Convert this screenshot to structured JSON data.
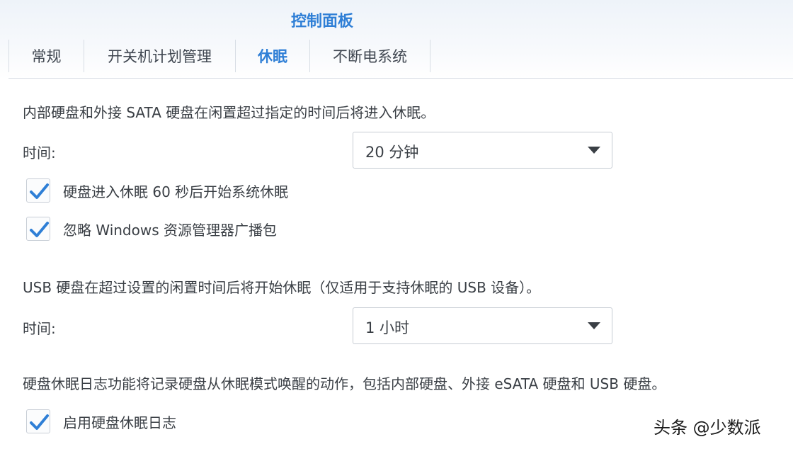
{
  "window": {
    "title": "控制面板"
  },
  "tabs": [
    {
      "label": "常规"
    },
    {
      "label": "开关机计划管理"
    },
    {
      "label": "休眠",
      "active": true
    },
    {
      "label": "不断电系统"
    }
  ],
  "internal_disk": {
    "description": "内部硬盘和外接 SATA 硬盘在闲置超过指定的时间后将进入休眠。",
    "time_label": "时间:",
    "time_value": "20 分钟",
    "options": [
      {
        "label": "硬盘进入休眠 60 秒后开始系统休眠",
        "checked": true
      },
      {
        "label": "忽略 Windows 资源管理器广播包",
        "checked": true
      }
    ]
  },
  "usb_disk": {
    "description": "USB 硬盘在超过设置的闲置时间后将开始休眠（仅适用于支持休眠的 USB 设备）。",
    "time_label": "时间:",
    "time_value": "1 小时"
  },
  "hibernation_log": {
    "description": "硬盘休眠日志功能将记录硬盘从休眠模式唤醒的动作，包括内部硬盘、外接 eSATA 硬盘和 USB 硬盘。",
    "option": {
      "label": "启用硬盘休眠日志",
      "checked": true
    }
  },
  "watermark": "头条 @少数派",
  "colors": {
    "accent": "#2f7fd6",
    "text": "#3a3f45",
    "border": "#c6ccd3"
  },
  "icons": {
    "checkbox_checked": "checkmark-icon",
    "dropdown": "caret-down-icon"
  }
}
